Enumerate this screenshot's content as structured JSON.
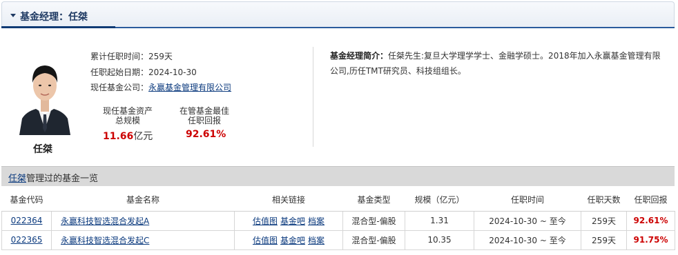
{
  "header": {
    "title": "基金经理：任桀"
  },
  "manager": {
    "name": "任桀",
    "tenure_label": "累计任职时间：",
    "tenure_value": "259天",
    "start_label": "任职起始日期：",
    "start_value": "2024-10-30",
    "company_label": "现任基金公司：",
    "company_value": "永赢基金管理有限公司",
    "aum_label_1": "现任基金资产",
    "aum_label_2": "总规模",
    "aum_value": "11.66",
    "aum_unit": "亿元",
    "best_label_1": "在管基金最佳",
    "best_label_2": "任职回报",
    "best_value": "92.61%"
  },
  "bio": {
    "label": "基金经理简介：",
    "text": "任桀先生:复旦大学理学学士、金融学硕士。2018年加入永赢基金管理有限公司,历任TMT研究员、科技组组长。"
  },
  "fund_list": {
    "title_link": "任桀",
    "title_rest": "管理过的基金一览",
    "columns": [
      "基金代码",
      "基金名称",
      "相关链接",
      "基金类型",
      "规模（亿元）",
      "任职时间",
      "任职天数",
      "任职回报"
    ],
    "rows": [
      {
        "code": "022364",
        "name": "永赢科技智选混合发起A",
        "links": [
          "估值图",
          "基金吧",
          "档案"
        ],
        "type": "混合型-偏股",
        "size": "1.31",
        "period": "2024-10-30 ~ 至今",
        "days": "259天",
        "return": "92.61%"
      },
      {
        "code": "022365",
        "name": "永赢科技智选混合发起C",
        "links": [
          "估值图",
          "基金吧",
          "档案"
        ],
        "type": "混合型-偏股",
        "size": "10.35",
        "period": "2024-10-30 ~ 至今",
        "days": "259天",
        "return": "91.75%"
      }
    ]
  },
  "colors": {
    "accent": "#2a5b9c",
    "return_red": "#cc0000",
    "link": "#0b3a7e"
  },
  "photo": {
    "icon": "manager-portrait"
  }
}
